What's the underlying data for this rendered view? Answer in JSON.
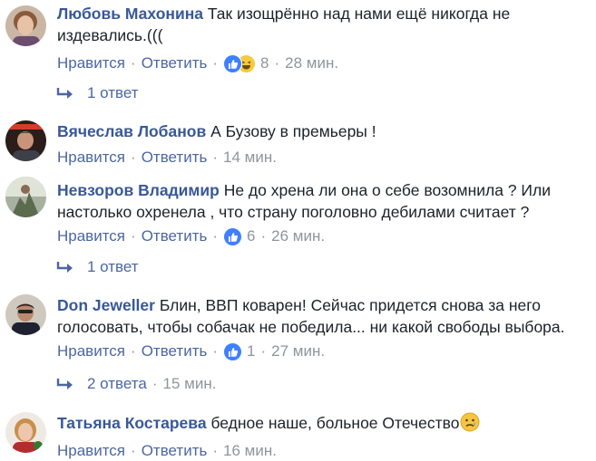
{
  "comments": [
    {
      "author": "Любовь Махонина",
      "text": "Так изощрённо над нами ещё никогда не издевались.(((",
      "like_label": "Нравится",
      "reply_label": "Ответить",
      "reaction_count": "8",
      "time": "28 мин.",
      "reactions": [
        "like-icon",
        "haha-icon"
      ]
    },
    {
      "author": "Вячеслав Лобанов",
      "text": "А Бузову в премьеры !",
      "like_label": "Нравится",
      "reply_label": "Ответить",
      "time": "14 мин."
    },
    {
      "author": "Невзоров Владимир",
      "text": "Не до хрена ли она о себе возомнила ? Или настолько охренела , что страну поголовно дебилами считает ?",
      "like_label": "Нравится",
      "reply_label": "Ответить",
      "reaction_count": "6",
      "time": "26 мин.",
      "reactions": [
        "like-icon"
      ]
    },
    {
      "author": "Don Jeweller",
      "text": "Блин, ВВП коварен! Сейчас придется снова за него голосовать, чтобы собачак не победила... ни какой свободы выбора.",
      "like_label": "Нравится",
      "reply_label": "Ответить",
      "reaction_count": "1",
      "time": "27 мин.",
      "reactions": [
        "like-icon"
      ]
    },
    {
      "author": "Татьяна Костарева",
      "text": "бедное наше, больное Отечество",
      "like_label": "Нравится",
      "reply_label": "Ответить",
      "time": "16 мин.",
      "emoji": "sad-face-icon"
    }
  ],
  "replies": [
    {
      "label": "1 ответ"
    },
    {
      "label": "1 ответ"
    },
    {
      "label": "2 ответа",
      "time": "15 мин."
    }
  ],
  "colors": {
    "author": "#385898",
    "link": "#4b67a1",
    "meta": "#90949c",
    "text": "#1d2129",
    "like": "#4080ff",
    "haha": "#f7c93e"
  }
}
